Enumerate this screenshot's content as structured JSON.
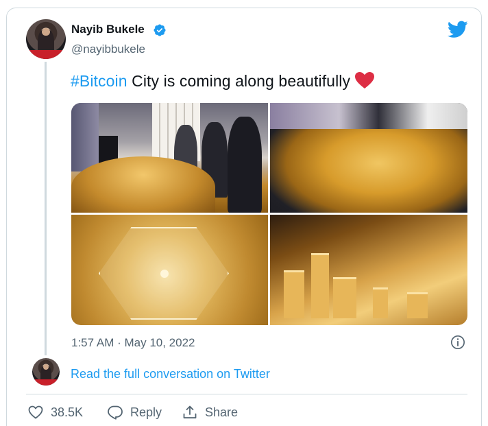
{
  "author": {
    "name": "Nayib Bukele",
    "handle": "@nayibbukele",
    "verified": true
  },
  "tweet": {
    "hashtag": "#Bitcoin",
    "text": " City is coming along beautifully",
    "emoji": "red-heart",
    "media_count": 4,
    "timestamp": "1:57 AM · May 10, 2022"
  },
  "read_link": "Read the full conversation on Twitter",
  "actions": {
    "like_count": "38.5K",
    "reply_label": "Reply",
    "share_label": "Share"
  },
  "colors": {
    "accent": "#1d9bf0",
    "heart": "#e0245e",
    "text": "#0f1419",
    "muted": "#536471",
    "border": "#cfd9de"
  },
  "icons": [
    "verified-icon",
    "twitter-logo-icon",
    "heart-emoji-icon",
    "info-icon",
    "like-icon",
    "reply-icon",
    "share-icon"
  ]
}
